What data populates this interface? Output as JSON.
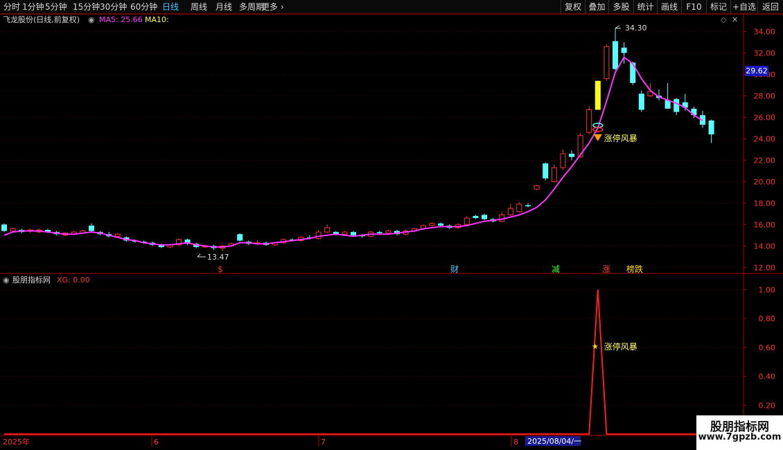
{
  "toolbar": {
    "periods": [
      {
        "label": "分时",
        "active": false
      },
      {
        "label": "1分钟",
        "active": false
      },
      {
        "label": "5分钟",
        "active": false
      },
      {
        "label": "15分钟",
        "active": false
      },
      {
        "label": "30分钟",
        "active": false
      },
      {
        "label": "60分钟",
        "active": false
      },
      {
        "label": "日线",
        "active": true
      },
      {
        "label": "周线",
        "active": false
      },
      {
        "label": "月线",
        "active": false
      },
      {
        "label": "多周期",
        "active": false
      },
      {
        "label": "更多",
        "active": false
      }
    ],
    "right_buttons": [
      "复权",
      "叠加",
      "多股",
      "统计",
      "画线",
      "F10",
      "标记",
      "+自选",
      "返回"
    ]
  },
  "main": {
    "title": "飞龙股份(日线,前复权)",
    "ma5_label": "MA5: 25.66",
    "ma10_label": "MA10:",
    "current_price": "29.62",
    "max_label": "34.30",
    "min_label": "13.47",
    "signal_label": "涨停风暴",
    "y_ticks": [
      "34.00",
      "32.00",
      "30.00",
      "28.00",
      "26.00",
      "24.00",
      "22.00",
      "20.00",
      "18.00",
      "16.00",
      "14.00",
      "12.00"
    ],
    "markers": [
      {
        "text": "$",
        "color": "#ff3030"
      },
      {
        "text": "财",
        "color": "#3ec8ff"
      },
      {
        "text": "减",
        "color": "#30ff30"
      },
      {
        "text": "涨",
        "color": "#ff3030"
      },
      {
        "text": "榜跌",
        "color": "#ffdd00"
      }
    ],
    "colors": {
      "up": "#ff3232",
      "down": "#54ffff",
      "ma": "#ff33ff",
      "limit_up": "#ffff00"
    }
  },
  "indicator": {
    "title": "股朋指标网",
    "xg_label": "XG: 0.00",
    "y_ticks": [
      "1.00",
      "0.80",
      "0.60",
      "0.40",
      "0.20"
    ],
    "signal_label": "涨停风暴",
    "color": "#ff1a1a"
  },
  "date_axis": {
    "labels": [
      "2025年",
      "6",
      "7",
      "8"
    ],
    "cursor_label": "2025/08/04/一"
  },
  "watermark": {
    "line1": "股朋指标网",
    "line2": "www.7gpzb.com"
  },
  "chart_data": [
    {
      "type": "candlestick",
      "title": "飞龙股份(日线,前复权)",
      "ylim": [
        11.5,
        35.0
      ],
      "series": [
        {
          "name": "MA5",
          "values": [
            15.0,
            15.3,
            15.4,
            15.4,
            15.4,
            15.3,
            15.2,
            15.1,
            15.1,
            15.2,
            15.3,
            15.2,
            15.0,
            14.8,
            14.6,
            14.5,
            14.3,
            14.2,
            14.1,
            14.1,
            14.2,
            14.3,
            14.1,
            14.0,
            13.9,
            13.9,
            14.0,
            14.3,
            14.3,
            14.2,
            14.2,
            14.3,
            14.4,
            14.5,
            14.6,
            14.7,
            14.9,
            15.0,
            15.1,
            15.0,
            14.9,
            15.0,
            15.1,
            15.1,
            15.1,
            15.2,
            15.3,
            15.4,
            15.6,
            15.7,
            15.8,
            15.8,
            15.8,
            15.9,
            16.1,
            16.3,
            16.4,
            16.5,
            16.7,
            16.9,
            17.2,
            17.6,
            18.3,
            19.3,
            20.4,
            21.4,
            22.5,
            23.6,
            25.0,
            27.5,
            30.2,
            31.6,
            31.0,
            29.6,
            28.5,
            27.9,
            27.6,
            27.3,
            26.9,
            26.2,
            25.7
          ]
        }
      ],
      "candles": [
        [
          16.0,
          15.4,
          16.1,
          15.3
        ],
        [
          15.4,
          15.6,
          15.7,
          15.3
        ],
        [
          15.5,
          15.3,
          15.6,
          15.2
        ],
        [
          15.4,
          15.5,
          15.6,
          15.2
        ],
        [
          15.3,
          15.5,
          15.6,
          15.2
        ],
        [
          15.5,
          15.3,
          15.6,
          15.2
        ],
        [
          15.3,
          15.1,
          15.4,
          15.0
        ],
        [
          15.0,
          15.2,
          15.3,
          14.9
        ],
        [
          15.1,
          15.3,
          15.4,
          15.0
        ],
        [
          15.2,
          15.4,
          15.5,
          15.1
        ],
        [
          15.9,
          15.4,
          16.1,
          15.3
        ],
        [
          15.3,
          15.1,
          15.4,
          15.0
        ],
        [
          15.1,
          14.9,
          15.3,
          14.8
        ],
        [
          14.9,
          15.1,
          15.2,
          14.8
        ],
        [
          14.8,
          14.5,
          14.9,
          14.4
        ],
        [
          14.5,
          14.4,
          14.6,
          14.3
        ],
        [
          14.4,
          14.3,
          14.5,
          14.2
        ],
        [
          14.3,
          14.1,
          14.4,
          14.0
        ],
        [
          14.1,
          13.9,
          14.2,
          13.8
        ],
        [
          13.9,
          14.1,
          14.2,
          13.8
        ],
        [
          14.1,
          14.6,
          14.7,
          14.0
        ],
        [
          14.6,
          14.2,
          14.7,
          14.1
        ],
        [
          14.2,
          13.9,
          14.3,
          13.8
        ],
        [
          13.9,
          14.0,
          14.1,
          13.8
        ],
        [
          14.0,
          13.8,
          14.1,
          13.6
        ],
        [
          13.8,
          14.0,
          14.1,
          13.5
        ],
        [
          14.0,
          14.2,
          14.3,
          13.9
        ],
        [
          15.1,
          14.5,
          15.2,
          14.4
        ],
        [
          14.4,
          14.2,
          14.5,
          14.1
        ],
        [
          14.2,
          14.3,
          14.5,
          14.1
        ],
        [
          14.3,
          14.1,
          14.4,
          14.0
        ],
        [
          14.1,
          14.3,
          14.4,
          14.0
        ],
        [
          14.3,
          14.6,
          14.7,
          14.2
        ],
        [
          14.6,
          14.5,
          14.7,
          14.4
        ],
        [
          14.5,
          14.8,
          14.9,
          14.4
        ],
        [
          14.8,
          14.7,
          15.0,
          14.6
        ],
        [
          14.7,
          15.3,
          15.5,
          14.6
        ],
        [
          15.3,
          15.7,
          16.0,
          15.2
        ],
        [
          15.3,
          15.1,
          15.4,
          15.0
        ],
        [
          15.1,
          15.3,
          15.4,
          15.0
        ],
        [
          15.3,
          15.0,
          15.4,
          14.9
        ],
        [
          15.0,
          14.9,
          15.1,
          14.8
        ],
        [
          14.9,
          15.3,
          15.4,
          14.8
        ],
        [
          15.3,
          15.2,
          15.4,
          15.1
        ],
        [
          15.2,
          15.4,
          15.5,
          15.1
        ],
        [
          15.4,
          15.1,
          15.5,
          15.0
        ],
        [
          15.1,
          15.4,
          15.5,
          15.0
        ],
        [
          15.4,
          15.6,
          15.7,
          15.3
        ],
        [
          15.6,
          15.9,
          16.0,
          15.5
        ],
        [
          15.9,
          16.1,
          16.2,
          15.8
        ],
        [
          16.1,
          15.9,
          16.2,
          15.8
        ],
        [
          15.9,
          15.7,
          16.0,
          15.6
        ],
        [
          15.7,
          16.0,
          16.1,
          15.6
        ],
        [
          16.0,
          16.6,
          16.8,
          15.9
        ],
        [
          16.8,
          16.6,
          16.9,
          16.5
        ],
        [
          16.9,
          16.5,
          17.0,
          16.4
        ],
        [
          16.5,
          16.3,
          16.6,
          16.2
        ],
        [
          16.3,
          16.9,
          17.2,
          16.2
        ],
        [
          16.9,
          17.5,
          17.9,
          16.8
        ],
        [
          17.2,
          17.9,
          18.1,
          17.1
        ],
        [
          17.8,
          17.7,
          18.0,
          17.6
        ],
        [
          19.3,
          19.6,
          19.7,
          19.2
        ],
        [
          21.7,
          20.3,
          21.8,
          20.1
        ],
        [
          20.0,
          21.3,
          21.6,
          19.9
        ],
        [
          21.3,
          22.6,
          23.0,
          21.1
        ],
        [
          22.6,
          22.3,
          22.9,
          22.0
        ],
        [
          22.3,
          24.3,
          24.5,
          22.2
        ],
        [
          24.6,
          26.7,
          27.0,
          24.4
        ],
        [
          26.7,
          29.4,
          29.4,
          26.7
        ],
        [
          29.6,
          32.6,
          32.8,
          29.4
        ],
        [
          33.1,
          30.5,
          34.3,
          30.4
        ],
        [
          32.5,
          32.0,
          33.0,
          31.0
        ],
        [
          31.1,
          29.2,
          31.2,
          29.0
        ],
        [
          28.2,
          26.7,
          28.5,
          26.5
        ],
        [
          28.0,
          28.4,
          29.2,
          27.9
        ],
        [
          28.0,
          27.8,
          28.6,
          27.6
        ],
        [
          27.6,
          26.8,
          29.2,
          27.5
        ],
        [
          27.7,
          26.5,
          27.8,
          26.2
        ],
        [
          27.4,
          26.9,
          28.2,
          26.6
        ],
        [
          26.8,
          26.2,
          27.0,
          25.9
        ],
        [
          26.2,
          25.3,
          26.6,
          25.0
        ],
        [
          25.7,
          24.4,
          25.8,
          23.6
        ]
      ]
    },
    {
      "type": "line",
      "title": "股朋指标网",
      "ylim": [
        0,
        1.05
      ],
      "series": [
        {
          "name": "XG",
          "values": [
            0,
            0,
            0,
            0,
            0,
            0,
            0,
            0,
            0,
            0,
            0,
            0,
            0,
            0,
            0,
            0,
            0,
            0,
            0,
            0,
            0,
            0,
            0,
            0,
            0,
            0,
            0,
            0,
            0,
            0,
            0,
            0,
            0,
            0,
            0,
            0,
            0,
            0,
            0,
            0,
            0,
            0,
            0,
            0,
            0,
            0,
            0,
            0,
            0,
            0,
            0,
            0,
            0,
            0,
            0,
            0,
            0,
            0,
            0,
            0,
            0,
            0,
            0,
            0,
            0,
            0,
            0,
            0,
            1,
            0,
            0,
            0,
            0,
            0,
            0,
            0,
            0,
            0,
            0,
            0,
            0,
            0
          ]
        }
      ]
    }
  ]
}
